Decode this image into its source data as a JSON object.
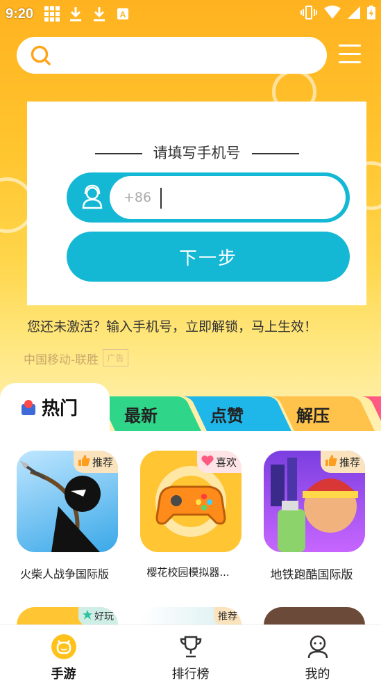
{
  "status_bar": {
    "time": "9:20",
    "icons": [
      "grid-icon",
      "download-icon",
      "download-icon",
      "a-badge-icon",
      "vibrate-icon",
      "wifi-icon",
      "signal-icon",
      "battery-icon"
    ]
  },
  "search": {
    "placeholder": "",
    "value": ""
  },
  "login_card": {
    "title": "请填写手机号",
    "phone_prefix": "+86",
    "phone_value": "",
    "next_label": "下一步"
  },
  "promo_text": "您还未激活？输入手机号，立即解锁，马上生效！",
  "carrier_text": "中国移动-联胜",
  "ad_label": "广告",
  "tabs": [
    {
      "label": "热门",
      "color": "#ffffff",
      "active": true
    },
    {
      "label": "最新",
      "color": "#2fd68a"
    },
    {
      "label": "点赞",
      "color": "#1fb7ea"
    },
    {
      "label": "解压",
      "color": "#ffc24a"
    },
    {
      "label": "",
      "color": "#ff5a82"
    }
  ],
  "games": [
    {
      "name": "火柴人战争国际版",
      "badge": "推荐",
      "badge_icon": "thumbs-up-icon"
    },
    {
      "name": "樱花校园模拟器...",
      "badge": "喜欢",
      "badge_icon": "heart-icon"
    },
    {
      "name": "地铁跑酷国际版",
      "badge": "推荐",
      "badge_icon": "thumbs-up-icon"
    }
  ],
  "partial_badges": [
    "好玩",
    "推荐"
  ],
  "bottom_nav": [
    {
      "label": "手游",
      "icon": "game-face-icon",
      "active": true
    },
    {
      "label": "排行榜",
      "icon": "trophy-icon"
    },
    {
      "label": "我的",
      "icon": "profile-icon"
    }
  ],
  "colors": {
    "accent": "#14b8d4",
    "hero": "#ffb21f",
    "nav_active": "#ffc21a"
  }
}
